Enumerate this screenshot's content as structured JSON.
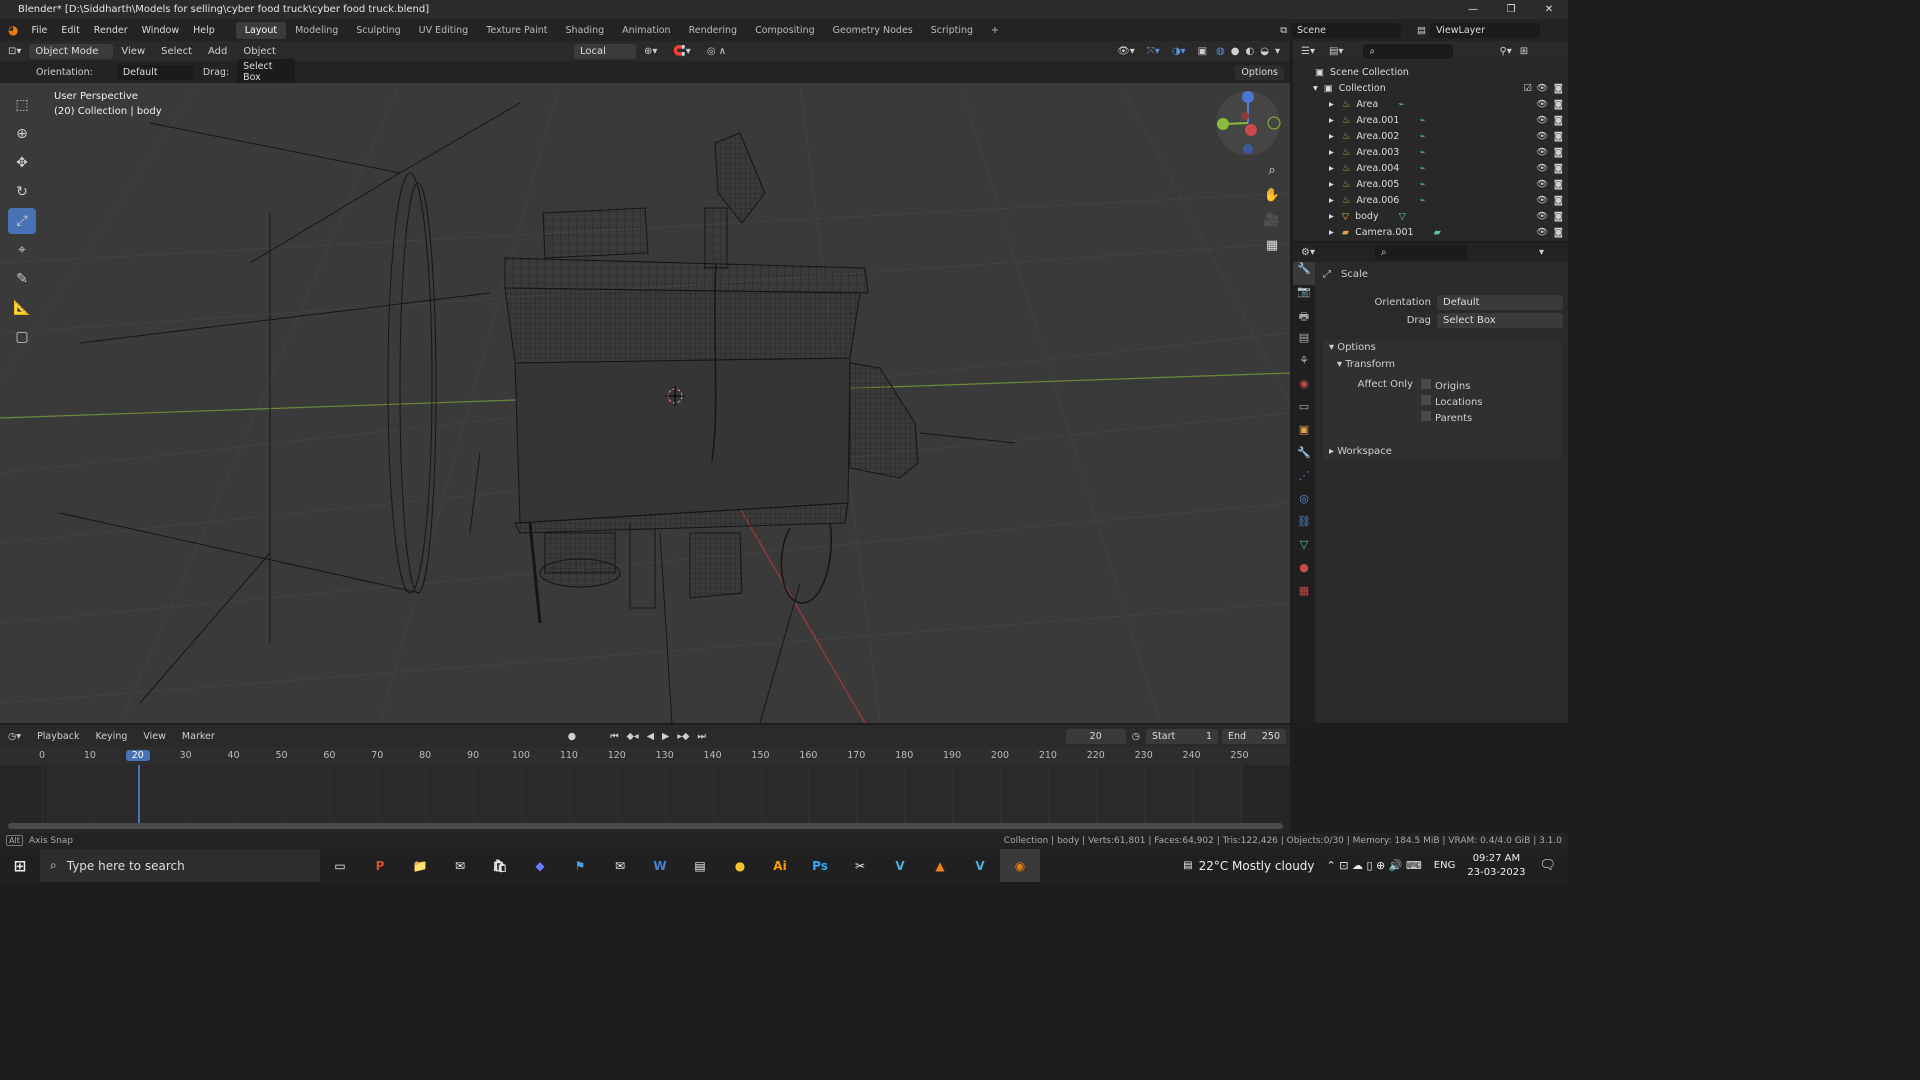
{
  "window": {
    "title": "Blender* [D:\\Siddharth\\Models for selling\\cyber food truck\\cyber food truck.blend]",
    "min": "—",
    "max": "❐",
    "close": "✕"
  },
  "menu": [
    "File",
    "Edit",
    "Render",
    "Window",
    "Help"
  ],
  "workspaces": [
    "Layout",
    "Modeling",
    "Sculpting",
    "UV Editing",
    "Texture Paint",
    "Shading",
    "Animation",
    "Rendering",
    "Compositing",
    "Geometry Nodes",
    "Scripting",
    "+"
  ],
  "scene": {
    "name": "Scene",
    "view_layer": "ViewLayer"
  },
  "vp_header": {
    "mode": "Object Mode",
    "view": "View",
    "select": "Select",
    "add": "Add",
    "object": "Object",
    "transform": "Local"
  },
  "tool_header": {
    "orientation_label": "Orientation:",
    "orientation": "Default",
    "drag_label": "Drag:",
    "drag": "Select Box",
    "options": "Options"
  },
  "viewport": {
    "perspective": "User Perspective",
    "collection": "(20) Collection | body"
  },
  "outliner": {
    "root": "Scene Collection",
    "collection": "Collection",
    "items": [
      "Area",
      "Area.001",
      "Area.002",
      "Area.003",
      "Area.004",
      "Area.005",
      "Area.006",
      "body",
      "Camera.001"
    ]
  },
  "properties": {
    "tool": "Scale",
    "orientation_label": "Orientation",
    "orientation": "Default",
    "drag_label": "Drag",
    "drag": "Select Box",
    "options": "Options",
    "transform": "Transform",
    "affect_only": "Affect Only",
    "checks": [
      "Origins",
      "Locations",
      "Parents"
    ],
    "workspace": "Workspace"
  },
  "timeline": {
    "menus": [
      "Playback",
      "Keying",
      "View",
      "Marker"
    ],
    "current_frame": "20",
    "start_label": "Start",
    "start": "1",
    "end_label": "End",
    "end": "250",
    "ticks": [
      "0",
      "10",
      "20",
      "30",
      "40",
      "50",
      "60",
      "70",
      "80",
      "90",
      "100",
      "110",
      "120",
      "130",
      "140",
      "150",
      "160",
      "170",
      "180",
      "190",
      "200",
      "210",
      "220",
      "230",
      "240",
      "250"
    ]
  },
  "status": {
    "left": "Axis Snap",
    "right": "Collection | body | Verts:61,801 | Faces:64,902 | Tris:122,426 | Objects:0/30 | Memory: 184.5 MiB | VRAM: 0.4/4.0 GiB | 3.1.0"
  },
  "taskbar": {
    "search": "Type here to search",
    "apps": [
      "P",
      "📁",
      "✉",
      "🛍",
      "◆",
      "⚑",
      "✉",
      "W",
      "▤",
      "●",
      "Ai",
      "Ps",
      "✂",
      "V",
      "▲",
      "V",
      "◉"
    ],
    "weather": "22°C  Mostly cloudy",
    "lang": "ENG",
    "time": "09:27 AM",
    "date": "23-03-2023"
  }
}
